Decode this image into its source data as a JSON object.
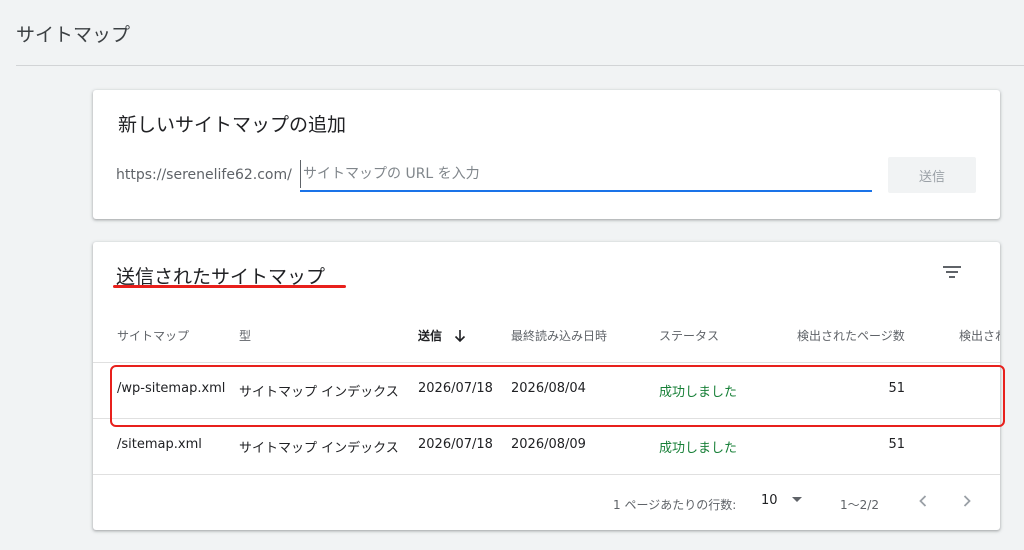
{
  "header": {
    "title": "サイトマップ"
  },
  "add_sitemap": {
    "heading": "新しいサイトマップの追加",
    "url_prefix": "https://serenelife62.com/",
    "input_value": "",
    "input_placeholder": "サイトマップの URL を入力",
    "submit_label": "送信"
  },
  "submitted": {
    "heading": "送信されたサイトマップ",
    "columns": [
      "サイトマップ",
      "型",
      "送信",
      "最終読み込み日時",
      "ステータス",
      "検出されたページ数",
      "検出され"
    ],
    "sorted_column": "送信",
    "rows": [
      {
        "sitemap": "/wp-sitemap.xml",
        "type": "サイトマップ インデックス",
        "submitted": "2026/07/18",
        "last_read": "2026/08/04",
        "status": "成功しました",
        "pages": "51"
      },
      {
        "sitemap": "/sitemap.xml",
        "type": "サイトマップ インデックス",
        "submitted": "2026/07/18",
        "last_read": "2026/08/09",
        "status": "成功しました",
        "pages": "51"
      }
    ],
    "pagination": {
      "rows_per_page_label": "1 ページあたりの行数:",
      "rows_per_page": "10",
      "range": "1〜2/2"
    }
  },
  "colors": {
    "accent": "#1a73e8",
    "success": "#188038",
    "annotation_red": "#e8201c"
  }
}
